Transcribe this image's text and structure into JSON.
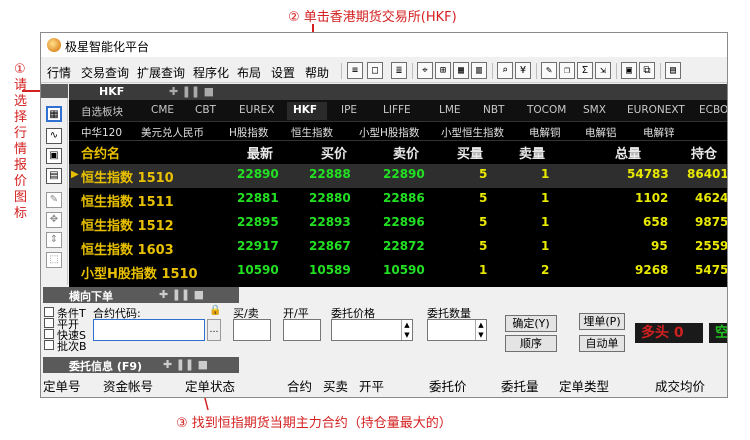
{
  "annotations": {
    "step1": "①请选择行情报价图标",
    "step2": "② 单击香港期货交易所(HKF)",
    "step3": "③ 找到恒指期货当期主力合约（持仓量最大的）"
  },
  "window": {
    "title": "极星智能化平台"
  },
  "menu": [
    "行情",
    "交易查询",
    "扩展查询",
    "程序化",
    "布局",
    "设置",
    "帮助"
  ],
  "panel_tab": "HKF",
  "market_tabs": [
    "自选板块",
    "CME",
    "CBT",
    "EUREX",
    "HKF",
    "IPE",
    "LIFFE",
    "LME",
    "NBT",
    "TOCOM",
    "SMX",
    "EURONEXT",
    "ECBOT"
  ],
  "selected_market": "HKF",
  "sub_tabs": [
    "中华120",
    "美元兑人民币",
    "H股指数",
    "恒生指数",
    "小型H股指数",
    "小型恒生指数",
    "电解铜",
    "电解铝",
    "电解锌"
  ],
  "columns": [
    "合约名",
    "最新",
    "买价",
    "卖价",
    "买量",
    "卖量",
    "总量",
    "持仓"
  ],
  "rows": [
    {
      "name": "恒生指数 1510",
      "last": "22890",
      "bid": "22888",
      "ask": "22890",
      "bidq": "5",
      "askq": "1",
      "vol": "54783",
      "oi": "86401"
    },
    {
      "name": "恒生指数 1511",
      "last": "22881",
      "bid": "22880",
      "ask": "22886",
      "bidq": "5",
      "askq": "1",
      "vol": "1102",
      "oi": "4624"
    },
    {
      "name": "恒生指数 1512",
      "last": "22895",
      "bid": "22893",
      "ask": "22896",
      "bidq": "5",
      "askq": "1",
      "vol": "658",
      "oi": "9875"
    },
    {
      "name": "恒生指数 1603",
      "last": "22917",
      "bid": "22867",
      "ask": "22872",
      "bidq": "5",
      "askq": "1",
      "vol": "95",
      "oi": "2559"
    },
    {
      "name": "小型H股指数 1510",
      "last": "10590",
      "bid": "10589",
      "ask": "10590",
      "bidq": "1",
      "askq": "2",
      "vol": "9268",
      "oi": "5475"
    }
  ],
  "order_panel": {
    "tab": "横向下单",
    "checkboxes": [
      "条件T",
      "平开",
      "快速S",
      "批次B"
    ],
    "labels": {
      "code": "合约代码:",
      "side": "买/卖",
      "open_close": "开/平",
      "price": "委托价格",
      "qty": "委托数量"
    },
    "buttons": {
      "confirm": "确定(Y)",
      "follow": "顺序",
      "park": "埋单(P)",
      "auto": "自动单"
    },
    "position_display": "多头 0",
    "status_text": "空"
  },
  "entrust_panel": {
    "tab": "委托信息 (F9)",
    "columns": [
      "定单号",
      "资金帐号",
      "定单状态",
      "合约",
      "买卖",
      "开平",
      "委托价",
      "委托量",
      "定单类型",
      "成交均价"
    ]
  }
}
